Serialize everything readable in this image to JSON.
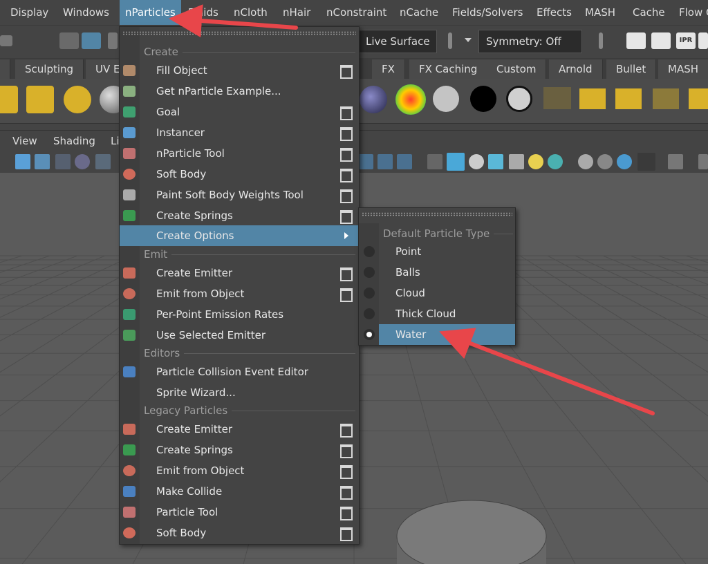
{
  "menubar": {
    "items": [
      "Display",
      "Windows",
      "nParticles",
      "Fluids",
      "nCloth",
      "nHair",
      "nConstraint",
      "nCache",
      "Fields/Solvers",
      "Effects",
      "MASH",
      "Cache",
      "Flow C"
    ],
    "active": "nParticles"
  },
  "status_line": {
    "live_surface": "Live Surface",
    "symmetry": "Symmetry: Off",
    "ipr": "IPR"
  },
  "shelf_tabs": [
    "Sculpting",
    "UV E",
    "FX",
    "FX Caching",
    "Custom",
    "Arnold",
    "Bullet",
    "MASH"
  ],
  "viewport": {
    "menus": [
      "View",
      "Shading",
      "Li"
    ]
  },
  "nparticles_menu": {
    "sections": {
      "create": "Create",
      "emit": "Emit",
      "editors": "Editors",
      "legacy": "Legacy Particles"
    },
    "items": [
      {
        "label": "Fill Object",
        "icon": "fill-object-icon",
        "option_box": true
      },
      {
        "label": "Get nParticle Example...",
        "icon": "example-icon",
        "option_box": false
      },
      {
        "label": "Goal",
        "icon": "goal-icon",
        "option_box": true
      },
      {
        "label": "Instancer",
        "icon": "instancer-icon",
        "option_box": true
      },
      {
        "label": "nParticle Tool",
        "icon": "nparticle-tool-icon",
        "option_box": true
      },
      {
        "label": "Soft Body",
        "icon": "soft-body-icon",
        "option_box": true
      },
      {
        "label": "Paint Soft Body Weights Tool",
        "icon": "paint-weights-icon",
        "option_box": true
      },
      {
        "label": "Create Springs",
        "icon": "springs-icon",
        "option_box": true
      },
      {
        "label": "Create Options",
        "icon": "",
        "option_box": false,
        "submenu": true,
        "highlighted": true
      },
      {
        "label": "Create Emitter",
        "icon": "emitter-icon",
        "option_box": true
      },
      {
        "label": "Emit from Object",
        "icon": "emit-object-icon",
        "option_box": true
      },
      {
        "label": "Per-Point Emission Rates",
        "icon": "emission-rates-icon",
        "option_box": false
      },
      {
        "label": "Use Selected Emitter",
        "icon": "selected-emitter-icon",
        "option_box": false
      },
      {
        "label": "Particle Collision Event Editor",
        "icon": "collision-event-icon",
        "option_box": false
      },
      {
        "label": "Sprite Wizard...",
        "icon": "",
        "option_box": false
      },
      {
        "label": "Create Emitter",
        "icon": "emitter-icon",
        "option_box": true
      },
      {
        "label": "Create Springs",
        "icon": "springs-icon",
        "option_box": true
      },
      {
        "label": "Emit from Object",
        "icon": "emit-object-icon",
        "option_box": true
      },
      {
        "label": "Make Collide",
        "icon": "make-collide-icon",
        "option_box": true
      },
      {
        "label": "Particle Tool",
        "icon": "particle-tool-icon",
        "option_box": true
      },
      {
        "label": "Soft Body",
        "icon": "soft-body-icon",
        "option_box": true
      }
    ]
  },
  "create_options_submenu": {
    "section": "Default Particle Type",
    "options": [
      "Point",
      "Balls",
      "Cloud",
      "Thick Cloud",
      "Water"
    ],
    "selected": "Water"
  },
  "colors": {
    "highlight": "#5285a6",
    "menu_bg": "#444444",
    "annotation_arrow": "#e8464a"
  }
}
